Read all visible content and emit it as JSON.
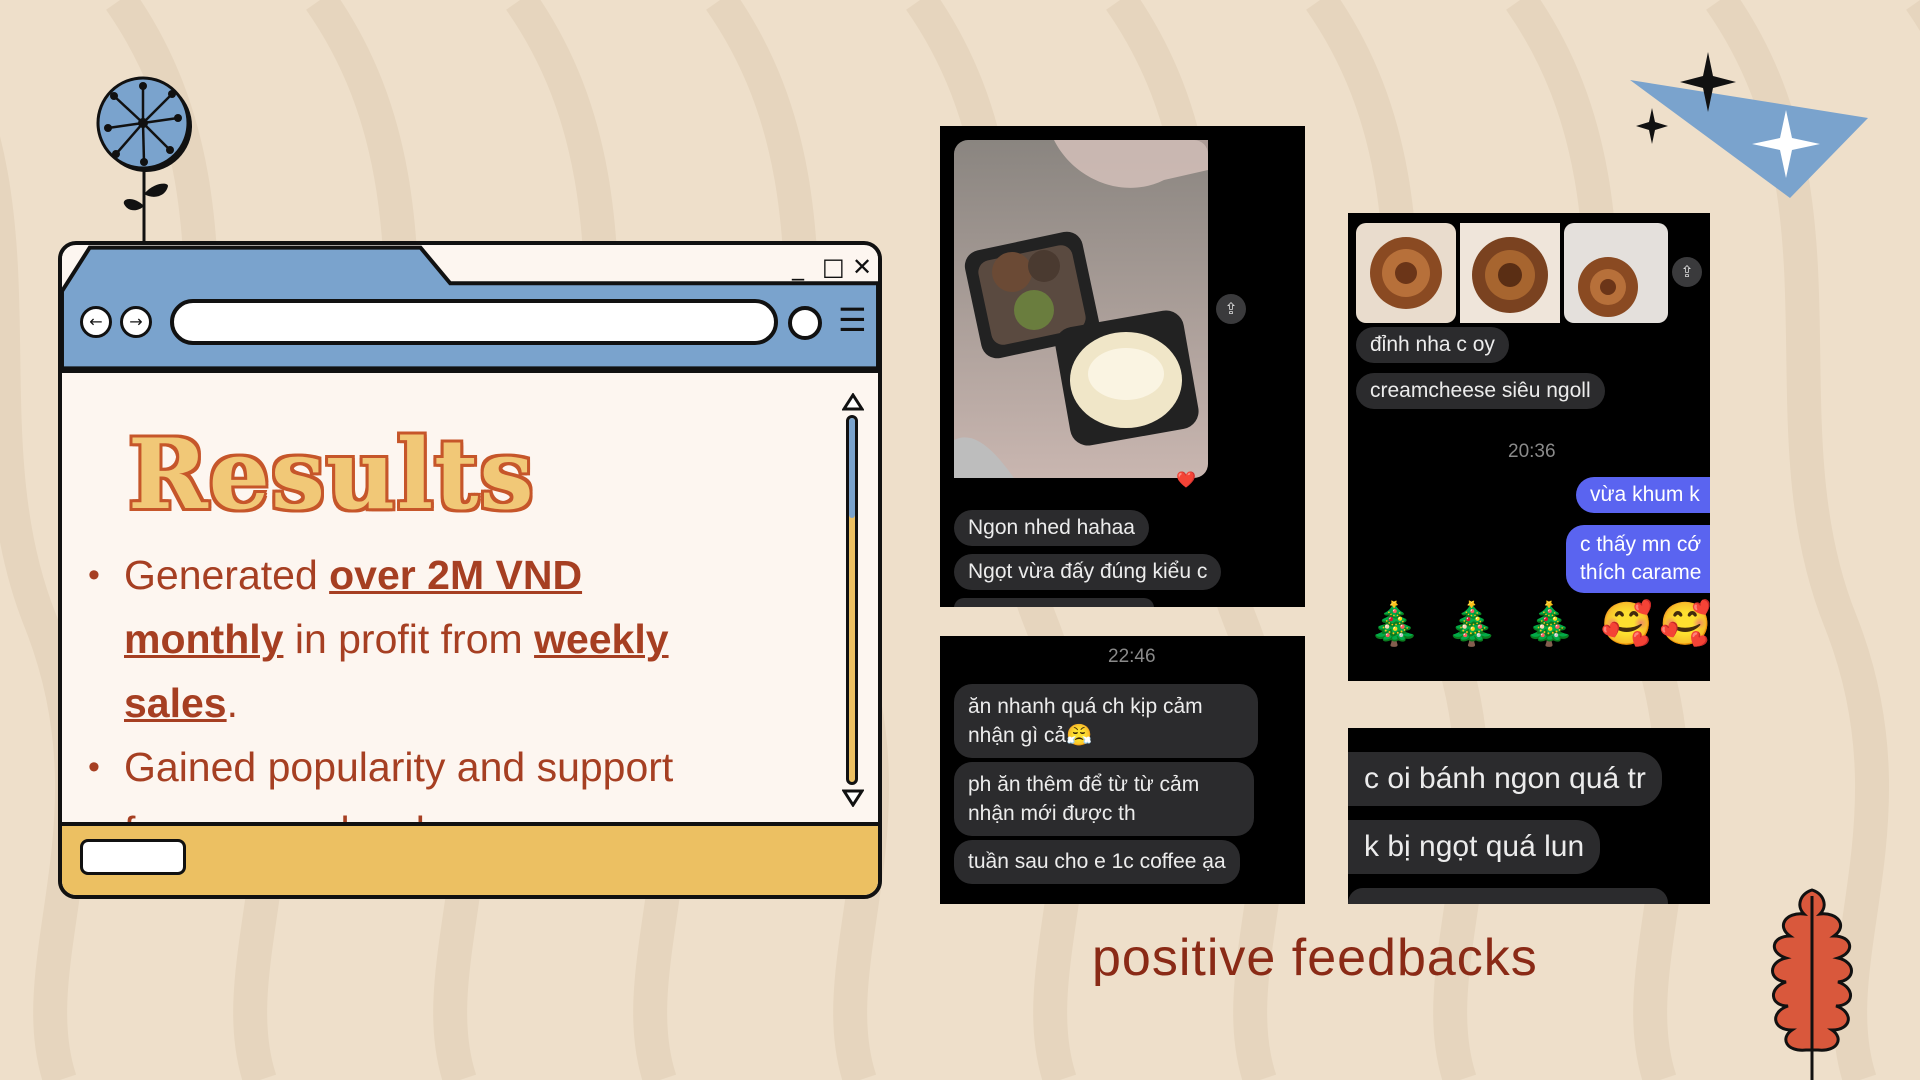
{
  "colors": {
    "background": "#eedfca",
    "window_bar": "#7aa3cd",
    "window_footer": "#ecc062",
    "body_text": "#a63f22",
    "caption": "#8a2a16",
    "title_fill": "#f1c877",
    "title_outline": "#c6562a"
  },
  "window": {
    "controls": {
      "minimize": "_",
      "maximize": "□",
      "close": "✕"
    },
    "nav": {
      "back": "←",
      "forward": "→",
      "menu": "☰"
    }
  },
  "results": {
    "title": "Results",
    "bullet1": {
      "pre": "Generated ",
      "highlight1": "over 2M VND monthly",
      "mid": " in profit from ",
      "highlight2": "weekly sales",
      "post": "."
    },
    "bullet2": "Gained popularity and support from young locals."
  },
  "feedback": {
    "caption": "positive feedbacks",
    "panel1": {
      "bubble1": "Ngon nhed hahaa",
      "bubble2": "Ngọt vừa đấy đúng kiểu c",
      "reaction": "❤️"
    },
    "panel2": {
      "bubble1": "đỉnh nha c oy",
      "bubble2": "creamcheese siêu ngoll",
      "time": "20:36",
      "me1": "vừa khum k",
      "me2": "c thấy mn cớ thích carame",
      "emojis": "🎄 🎄 🎄 🥰🥰🥰"
    },
    "panel3": {
      "time": "22:46",
      "bubble1": "ăn nhanh quá ch kịp cảm nhận gì cả😤",
      "bubble2": "ph ăn thêm để từ từ cảm nhận mới được th",
      "bubble3": "tuần sau cho e 1c coffee ạa"
    },
    "panel4": {
      "bubble1": "c oi bánh ngon quá tr",
      "bubble2": "k bị ngọt quá lun"
    }
  },
  "icons": [
    "flower-icon",
    "sparkle-star-icon",
    "leaf-icon",
    "share-icon",
    "heart-icon",
    "scroll-up-icon",
    "scroll-down-icon"
  ]
}
